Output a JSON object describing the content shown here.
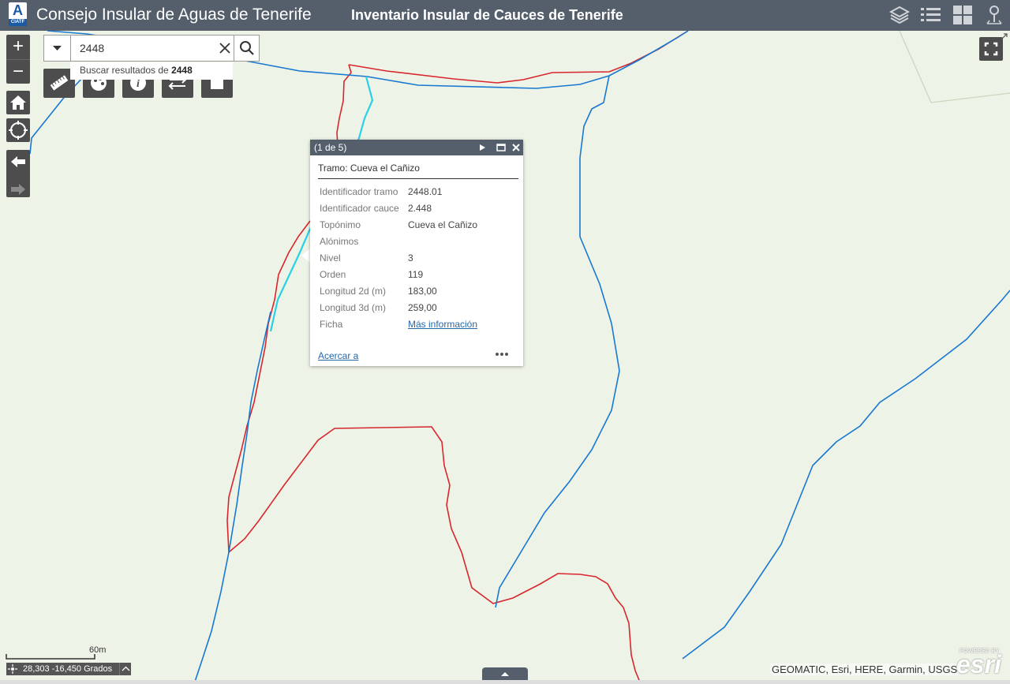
{
  "header": {
    "logo_text": "CIATF",
    "org_title": "Consejo Insular de Aguas de Tenerife",
    "app_title": "Inventario Insular de Cauces de Tenerife",
    "icons": [
      "layers-icon",
      "legend-list-icon",
      "basemap-gallery-icon",
      "location-pin-icon"
    ]
  },
  "map_controls": {
    "zoom_in": "+",
    "zoom_out": "−",
    "icons": [
      "home-icon",
      "locate-icon",
      "previous-extent-icon",
      "next-extent-icon"
    ]
  },
  "search": {
    "value": "2448",
    "suggestion_prefix": "Buscar resultados de",
    "suggestion_term": "2448"
  },
  "toolbar": {
    "icons": [
      "measure-ruler-icon",
      "palette-icon",
      "info-icon",
      "coordinate-xyz-icon",
      "print-icon"
    ]
  },
  "popup": {
    "count": "(1 de 5)",
    "title": "Tramo: Cueva el Cañizo",
    "attributes": [
      {
        "label": "Identificador tramo",
        "value": "2448.01"
      },
      {
        "label": "Identificador cauce",
        "value": "2.448"
      },
      {
        "label": "Topónimo",
        "value": "Cueva el Cañizo"
      },
      {
        "label": "Alónimos",
        "value": ""
      },
      {
        "label": "Nivel",
        "value": "3"
      },
      {
        "label": "Orden",
        "value": "119"
      },
      {
        "label": "Longitud 2d (m)",
        "value": "183,00"
      },
      {
        "label": "Longitud 3d (m)",
        "value": "259,00"
      },
      {
        "label": "Ficha",
        "value": "Más información"
      }
    ],
    "zoom_to": "Acercar a",
    "more": "•••"
  },
  "scalebar": {
    "label": "60m"
  },
  "coordinates": {
    "text": "28,303 -16,450 Grados"
  },
  "attribution": "GEOMATIC, Esri, HERE, Garmin, USGS",
  "esri": {
    "powered": "POWERED BY",
    "name": "esri"
  },
  "colors": {
    "header_bg": "#545f6b",
    "map_bg": "#eef3e7",
    "stream_blue": "#1778d2",
    "boundary_red": "#d9262c",
    "highlight_cyan": "#28d2e6",
    "link": "#2769a8"
  }
}
